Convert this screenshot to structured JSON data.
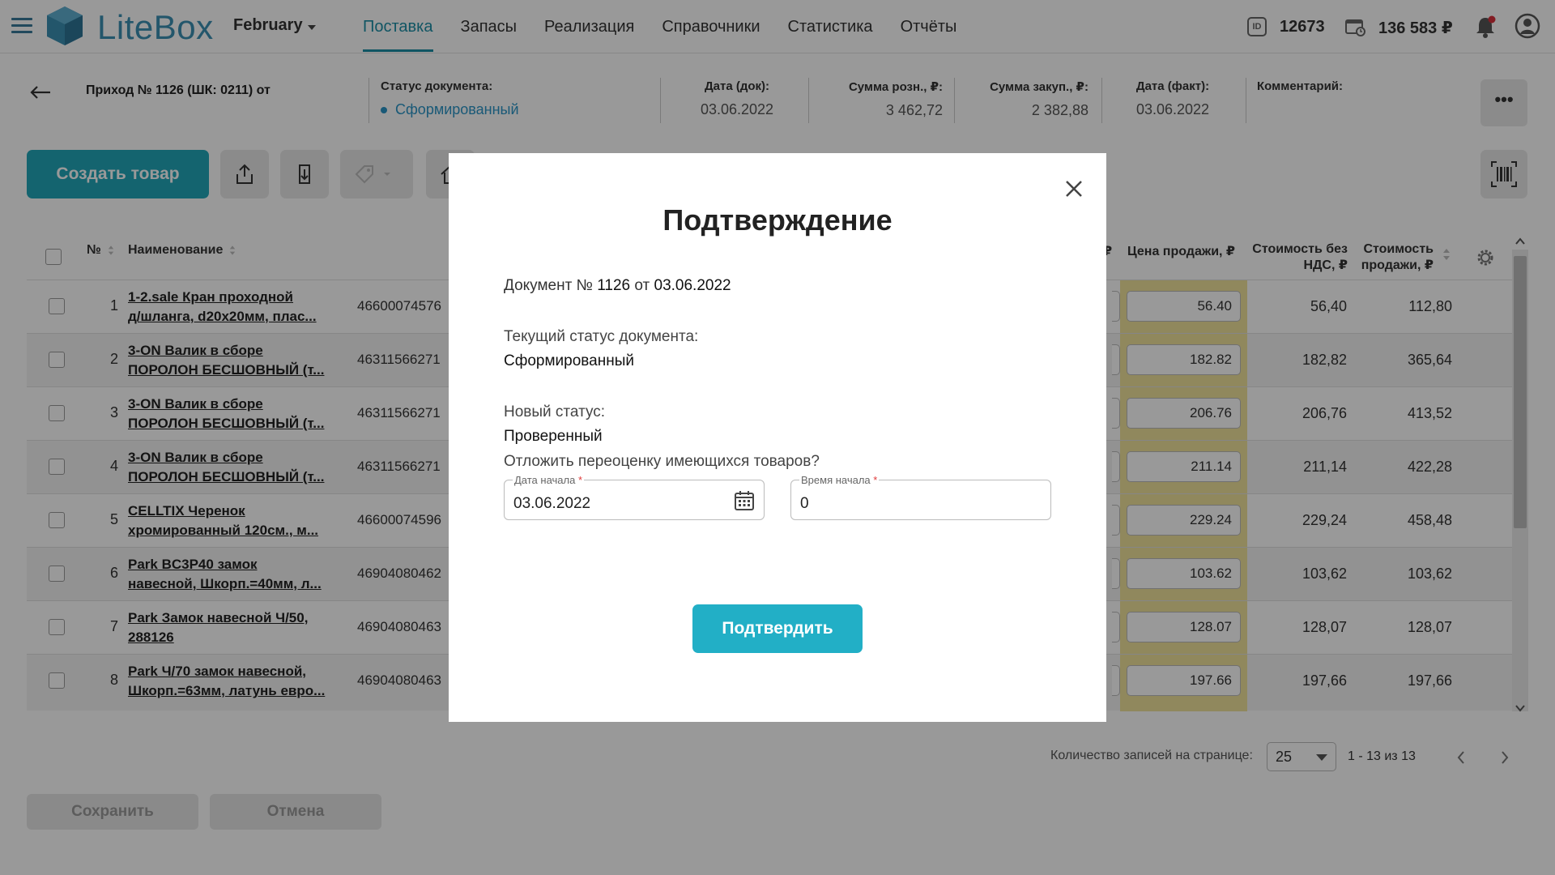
{
  "topbar": {
    "logo_text": "LiteBox",
    "month": "February",
    "nav": [
      "Поставка",
      "Запасы",
      "Реализация",
      "Справочники",
      "Статистика",
      "Отчёты"
    ],
    "id_badge": "ID",
    "user_id": "12673",
    "balance": "136 583 ₽"
  },
  "doc_header": {
    "title": "Приход № 1126 (ШК: 0211) от",
    "status_label": "Статус документа:",
    "status_value": "Сформированный",
    "date_doc_label": "Дата (док):",
    "date_doc_value": "03.06.2022",
    "sum_retail_label": "Сумма розн., ₽:",
    "sum_retail_value": "3 462,72",
    "sum_purchase_label": "Сумма закуп., ₽:",
    "sum_purchase_value": "2 382,88",
    "date_fact_label": "Дата (факт):",
    "date_fact_value": "03.06.2022",
    "comment_label": "Комментарий:",
    "more_label": "•••"
  },
  "toolbar": {
    "create_label": "Создать товар"
  },
  "table": {
    "headers": {
      "num": "№",
      "name": "Наименование",
      "col_stub": "₽",
      "price": "Цена продажи, ₽",
      "cost_line1": "Стоимость без",
      "cost_line2": "НДС, ₽",
      "sale_line1": "Стоимость",
      "sale_line2": "продажи, ₽"
    },
    "rows": [
      {
        "num": "1",
        "name1": "1-2.sale Кран проходной",
        "name2": "д/шланга, d20x20мм, плас...",
        "barcode": "46600074576",
        "price": "56.40",
        "cost": "56,40",
        "sale": "112,80"
      },
      {
        "num": "2",
        "name1": "3-ON Валик в сборе",
        "name2": "ПОРОЛОН БЕСШОВНЫЙ (т...",
        "barcode": "46311566271",
        "price": "182.82",
        "cost": "182,82",
        "sale": "365,64"
      },
      {
        "num": "3",
        "name1": "3-ON Валик в сборе",
        "name2": "ПОРОЛОН БЕСШОВНЫЙ (т...",
        "barcode": "46311566271",
        "price": "206.76",
        "cost": "206,76",
        "sale": "413,52"
      },
      {
        "num": "4",
        "name1": "3-ON Валик в сборе",
        "name2": "ПОРОЛОН БЕСШОВНЫЙ (т...",
        "barcode": "46311566271",
        "price": "211.14",
        "cost": "211,14",
        "sale": "422,28"
      },
      {
        "num": "5",
        "name1": "CELLTIX Черенок",
        "name2": "хромированный 120см., м...",
        "barcode": "46600074596",
        "price": "229.24",
        "cost": "229,24",
        "sale": "458,48"
      },
      {
        "num": "6",
        "name1": "Park BC3P40 замок",
        "name2": "навесной, Шкорп.=40мм, л...",
        "barcode": "46904080462",
        "price": "103.62",
        "cost": "103,62",
        "sale": "103,62"
      },
      {
        "num": "7",
        "name1": "Park Замок навесной Ч/50,",
        "name2": "288126",
        "barcode": "46904080463",
        "price": "128.07",
        "cost": "128,07",
        "sale": "128,07"
      },
      {
        "num": "8",
        "name1": "Park Ч/70 замок навесной,",
        "name2": "Шкорп.=63мм, латунь евро...",
        "barcode": "46904080463",
        "price": "197.66",
        "cost": "197,66",
        "sale": "197,66"
      }
    ]
  },
  "pager": {
    "label": "Количество записей на странице:",
    "per_page": "25",
    "range": "1 - 13 из 13"
  },
  "footer": {
    "save_label": "Сохранить",
    "cancel_label": "Отмена"
  },
  "modal": {
    "title": "Подтверждение",
    "doc_prefix": "Документ № ",
    "doc_number": "1126",
    "doc_from": " от ",
    "doc_date": "03.06.2022",
    "current_status_label": "Текущий статус документа:",
    "current_status_value": "Сформированный",
    "new_status_label": "Новый статус:",
    "new_status_value": "Проверенный",
    "postpone_question": "Отложить переоценку имеющихся товаров?",
    "start_date_label": "Дата начала",
    "start_date_value": "03.06.2022",
    "start_time_label": "Время начала",
    "start_time_value": "0",
    "required_mark": "*",
    "confirm_label": "Подтвердить"
  }
}
